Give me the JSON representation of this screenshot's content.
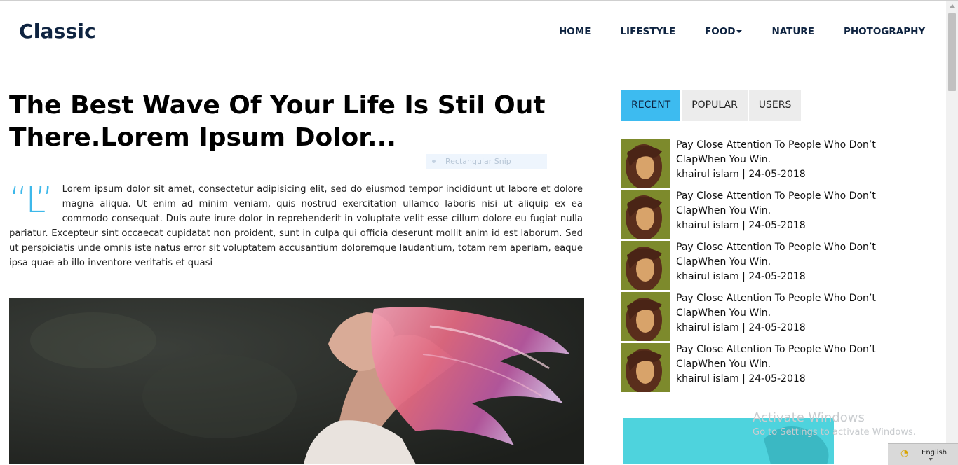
{
  "header": {
    "logo": "Classic",
    "nav": [
      {
        "label": "HOME",
        "name": "nav-home"
      },
      {
        "label": "LIFESTYLE",
        "name": "nav-lifestyle"
      },
      {
        "label": "FOOD",
        "name": "nav-food",
        "dropdown": true
      },
      {
        "label": "NATURE",
        "name": "nav-nature"
      },
      {
        "label": "PHOTOGRAPHY",
        "name": "nav-photography"
      }
    ]
  },
  "article": {
    "title": "The Best Wave Of Your Life Is Stil Out There.Lorem Ipsum Dolor...",
    "dropcap": "“L”",
    "intro": "Lorem ipsum dolor sit amet, consectetur adipisicing elit, sed do eiusmod tempor incididunt ut labore et dolore magna aliqua. Ut enim ad minim veniam, quis nostrud exercitation ullamco laboris nisi ut aliquip ex ea commodo consequat. Duis aute irure dolor in reprehenderit in voluptate velit esse cillum dolore eu fugiat nulla pariatur. Excepteur sint occaecat cupidatat non proident, sunt in culpa qui officia deserunt mollit anim id est laborum. Sed ut perspiciatis unde omnis iste natus error sit voluptatem accusantium doloremque laudantium, totam rem aperiam, eaque ipsa quae ab illo inventore veritatis et quasi"
  },
  "overlay": {
    "snip_label": "Rectangular Snip"
  },
  "sidebar": {
    "tabs": [
      {
        "label": "RECENT",
        "active": true
      },
      {
        "label": "POPULAR",
        "active": false
      },
      {
        "label": "USERS",
        "active": false
      }
    ],
    "posts": [
      {
        "title": "Pay Close Attention To People Who Don’t ClapWhen You Win.",
        "meta": "khairul islam | 24-05-2018"
      },
      {
        "title": "Pay Close Attention To People Who Don’t ClapWhen You Win.",
        "meta": "khairul islam | 24-05-2018"
      },
      {
        "title": "Pay Close Attention To People Who Don’t ClapWhen You Win.",
        "meta": "khairul islam | 24-05-2018"
      },
      {
        "title": "Pay Close Attention To People Who Don’t ClapWhen You Win.",
        "meta": "khairul islam | 24-05-2018"
      },
      {
        "title": "Pay Close Attention To People Who Don’t ClapWhen You Win.",
        "meta": "khairul islam | 24-05-2018"
      }
    ]
  },
  "system": {
    "watermark_title": "Activate Windows",
    "watermark_sub": "Go to Settings to activate Windows.",
    "language": "English"
  },
  "colors": {
    "accent": "#3dbbf0",
    "brand": "#0e2340"
  }
}
